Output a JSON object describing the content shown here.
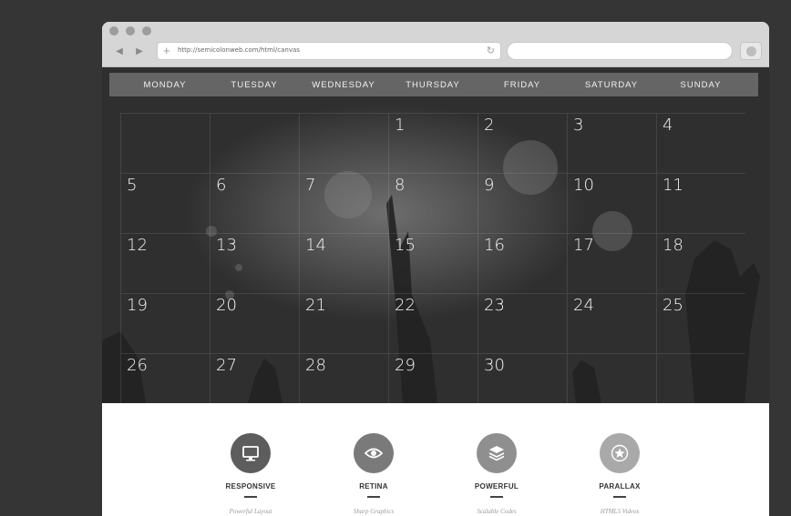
{
  "browser": {
    "url": "http://semicolonweb.com/html/canvas",
    "back_glyph": "◀",
    "forward_glyph": "▶",
    "new_tab_glyph": "+",
    "reload_glyph": "↻"
  },
  "calendar": {
    "weekdays": [
      "MONDAY",
      "TUESDAY",
      "WEDNESDAY",
      "THURSDAY",
      "FRIDAY",
      "SATURDAY",
      "SUNDAY"
    ],
    "weeks": [
      [
        "",
        "",
        "",
        "1",
        "2",
        "3",
        "4"
      ],
      [
        "5",
        "6",
        "7",
        "8",
        "9",
        "10",
        "11"
      ],
      [
        "12",
        "13",
        "14",
        "15",
        "16",
        "17",
        "18"
      ],
      [
        "19",
        "20",
        "21",
        "22",
        "23",
        "24",
        "25"
      ],
      [
        "26",
        "27",
        "28",
        "29",
        "30",
        "",
        ""
      ]
    ]
  },
  "features": [
    {
      "title": "RESPONSIVE",
      "subtitle": "Powerful Layout",
      "icon": "monitor-icon",
      "color": "#5d5d5d"
    },
    {
      "title": "RETINA",
      "subtitle": "Sharp Graphics",
      "icon": "eye-icon",
      "color": "#7a7a7a"
    },
    {
      "title": "POWERFUL",
      "subtitle": "Scalable Codes",
      "icon": "layers-icon",
      "color": "#8f8f8f"
    },
    {
      "title": "PARALLAX",
      "subtitle": "HTML5 Videos",
      "icon": "star-icon",
      "color": "#a9a9a9"
    }
  ]
}
